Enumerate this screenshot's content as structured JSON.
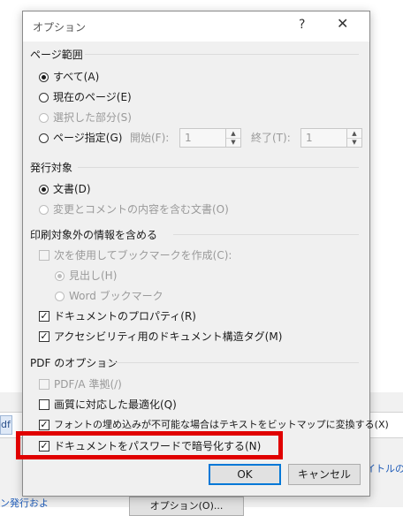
{
  "dialog": {
    "title": "オプション",
    "help": "?",
    "close": "✕"
  },
  "page_range": {
    "title": "ページ範囲",
    "all": "すべて(A)",
    "current": "現在のページ(E)",
    "selection": "選択した部分(S)",
    "pages": "ページ指定(G)",
    "from_label": "開始(F):",
    "from_value": "1",
    "to_label": "終了(T):",
    "to_value": "1"
  },
  "publish": {
    "title": "発行対象",
    "document": "文書(D)",
    "with_markup": "変更とコメントの内容を含む文書(O)"
  },
  "non_print": {
    "title": "印刷対象外の情報を含める",
    "bookmarks": "次を使用してブックマークを作成(C):",
    "headings": "見出し(H)",
    "word_bookmarks": "Word ブックマーク",
    "doc_properties": "ドキュメントのプロパティ(R)",
    "structure_tags": "アクセシビリティ用のドキュメント構造タグ(M)"
  },
  "pdf": {
    "title": "PDF のオプション",
    "pdfa": "PDF/A 準拠(/)",
    "optimize": "画質に対応した最適化(Q)",
    "bitmap": "フォントの埋め込みが不可能な場合はテキストをビットマップに変換する(X)",
    "encrypt": "ドキュメントをパスワードで暗号化する(N)"
  },
  "buttons": {
    "ok": "OK",
    "cancel": "キャンセル"
  },
  "background": {
    "tab_fragment": "df",
    "left_text": "ン発行およ",
    "right_text": "イトルの道",
    "button": "オプション(O)..."
  },
  "colors": {
    "highlight": "#e00000",
    "link": "#1e5bb8"
  }
}
